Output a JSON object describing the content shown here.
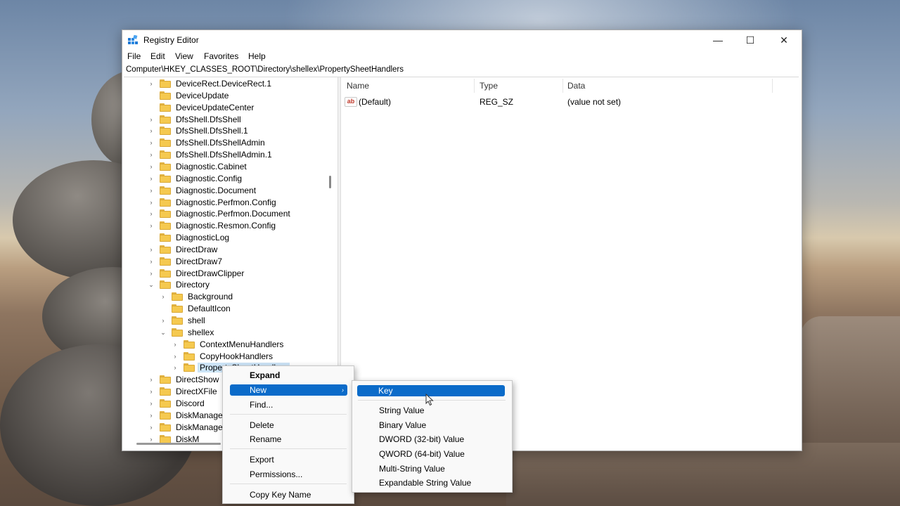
{
  "window": {
    "title": "Registry Editor",
    "controls": {
      "minimize": "—",
      "maximize": "☐",
      "close": "✕"
    }
  },
  "menu": {
    "file": "File",
    "edit": "Edit",
    "view": "View",
    "favorites": "Favorites",
    "help": "Help"
  },
  "address": "Computer\\HKEY_CLASSES_ROOT\\Directory\\shellex\\PropertySheetHandlers",
  "tree": {
    "items": [
      {
        "label": "DeviceRect.DeviceRect.1",
        "chevron": "›"
      },
      {
        "label": "DeviceUpdate",
        "chevron": ""
      },
      {
        "label": "DeviceUpdateCenter",
        "chevron": ""
      },
      {
        "label": "DfsShell.DfsShell",
        "chevron": "›"
      },
      {
        "label": "DfsShell.DfsShell.1",
        "chevron": "›"
      },
      {
        "label": "DfsShell.DfsShellAdmin",
        "chevron": "›"
      },
      {
        "label": "DfsShell.DfsShellAdmin.1",
        "chevron": "›"
      },
      {
        "label": "Diagnostic.Cabinet",
        "chevron": "›"
      },
      {
        "label": "Diagnostic.Config",
        "chevron": "›"
      },
      {
        "label": "Diagnostic.Document",
        "chevron": "›"
      },
      {
        "label": "Diagnostic.Perfmon.Config",
        "chevron": "›"
      },
      {
        "label": "Diagnostic.Perfmon.Document",
        "chevron": "›"
      },
      {
        "label": "Diagnostic.Resmon.Config",
        "chevron": "›"
      },
      {
        "label": "DiagnosticLog",
        "chevron": ""
      },
      {
        "label": "DirectDraw",
        "chevron": "›"
      },
      {
        "label": "DirectDraw7",
        "chevron": "›"
      },
      {
        "label": "DirectDrawClipper",
        "chevron": "›"
      },
      {
        "label": "Directory",
        "chevron": "⌄"
      },
      {
        "label": "Background",
        "chevron": "›"
      },
      {
        "label": "DefaultIcon",
        "chevron": ""
      },
      {
        "label": "shell",
        "chevron": "›"
      },
      {
        "label": "shellex",
        "chevron": "⌄"
      },
      {
        "label": "ContextMenuHandlers",
        "chevron": "›"
      },
      {
        "label": "CopyHookHandlers",
        "chevron": "›"
      },
      {
        "label": "PropertySheetHandlers",
        "chevron": "›"
      },
      {
        "label": "DirectShow",
        "chevron": "›"
      },
      {
        "label": "DirectXFile",
        "chevron": "›"
      },
      {
        "label": "Discord",
        "chevron": "›"
      },
      {
        "label": "DiskManagement",
        "chevron": "›"
      },
      {
        "label": "DiskManagement",
        "chevron": "›"
      },
      {
        "label": "DiskM",
        "chevron": "›"
      }
    ]
  },
  "values": {
    "headers": {
      "name": "Name",
      "type": "Type",
      "data": "Data"
    },
    "rows": [
      {
        "icon": "ab",
        "name": "(Default)",
        "type": "REG_SZ",
        "data": "(value not set)"
      }
    ]
  },
  "context_menu": {
    "expand": "Expand",
    "new": "New",
    "new_arrow": "›",
    "find": "Find...",
    "delete": "Delete",
    "rename": "Rename",
    "export": "Export",
    "permissions": "Permissions...",
    "copy_key_name": "Copy Key Name"
  },
  "submenu": {
    "key": "Key",
    "string_value": "String Value",
    "binary_value": "Binary Value",
    "dword": "DWORD (32-bit) Value",
    "qword": "QWORD (64-bit) Value",
    "multi_string": "Multi-String Value",
    "expandable_string": "Expandable String Value"
  },
  "colors": {
    "highlight": "#0b6bc9",
    "selection": "#cce4f7",
    "folder": "#f5c94f"
  }
}
